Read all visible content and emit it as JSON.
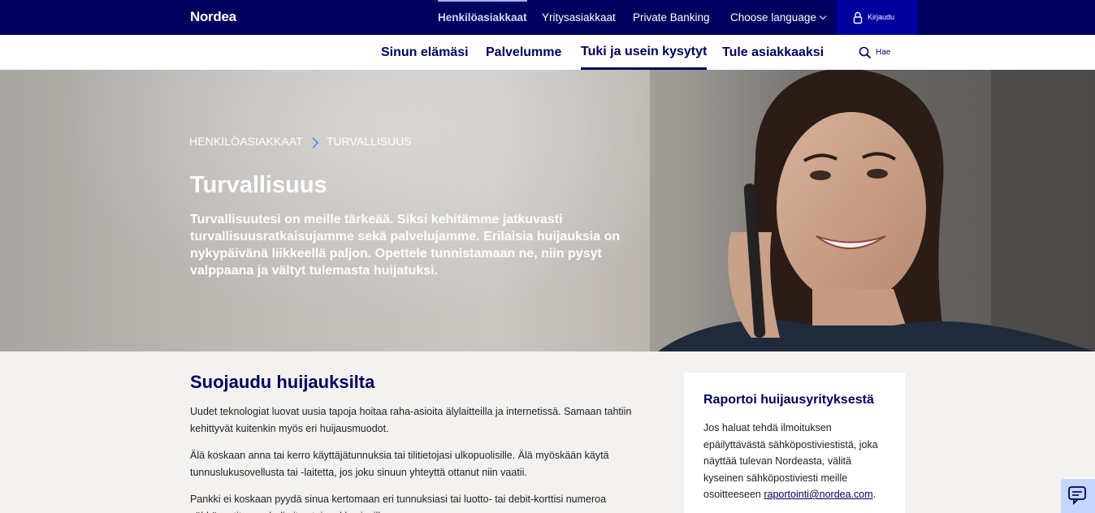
{
  "header": {
    "logo": "Nordea",
    "nav": [
      "Henkilöasiakkaat",
      "Yritysasiakkaat",
      "Private Banking"
    ],
    "language": "Choose language",
    "login": "Kirjaudu"
  },
  "subnav": {
    "items": [
      "Sinun elämäsi",
      "Palvelumme",
      "Tuki ja usein kysytyt",
      "Tule asiakkaaksi"
    ],
    "search": "Hae"
  },
  "hero": {
    "breadcrumb": [
      "HENKILÖASIAKKAAT",
      "TURVALLISUUS"
    ],
    "title": "Turvallisuus",
    "lead": "Turvallisuutesi on meille tärkeää. Siksi kehitämme jatkuvasti turvallisuusratkaisujamme sekä palvelujamme. Erilaisia huijauksia on nykypäivänä liikkeellä paljon. Opettele tunnistamaan ne, niin pysyt valppaana ja vältyt tulemasta huijatuksi."
  },
  "main": {
    "heading": "Suojaudu huijauksilta",
    "paragraphs": [
      "Uudet teknologiat luovat uusia tapoja hoitaa raha-asioita älylaitteilla ja internetissä. Samaan tahtiin kehittyvät kuitenkin myös eri huijausmuodot.",
      "Älä koskaan anna tai kerro käyttäjätunnuksia tai tilitietojasi ulkopuolisille. Älä myöskään käytä tunnuslukusovellusta tai -laitetta, jos joku sinuun yhteyttä ottanut niin vaatii.",
      "Pankki ei koskaan pyydä sinua kertomaan eri tunnuksiasi tai luotto- tai debit-korttisi numeroa sähköpostitse, puhelimitse tai verkkosivuilla."
    ]
  },
  "card": {
    "title": "Raportoi huijausyrityksestä",
    "text": "Jos haluat tehdä ilmoituksen epäilyttävästä sähköpostiviestistä, joka näyttää tulevan Nordeasta, välitä kyseinen sähköpostiviesti meille osoitteeseen ",
    "link": "raportointi@nordea.com",
    "end": "."
  },
  "colors": {
    "navy": "#00005e",
    "login_bg": "#0000a0",
    "chat_bg": "#c5d6ff",
    "page_bg": "#f4f2f0"
  }
}
